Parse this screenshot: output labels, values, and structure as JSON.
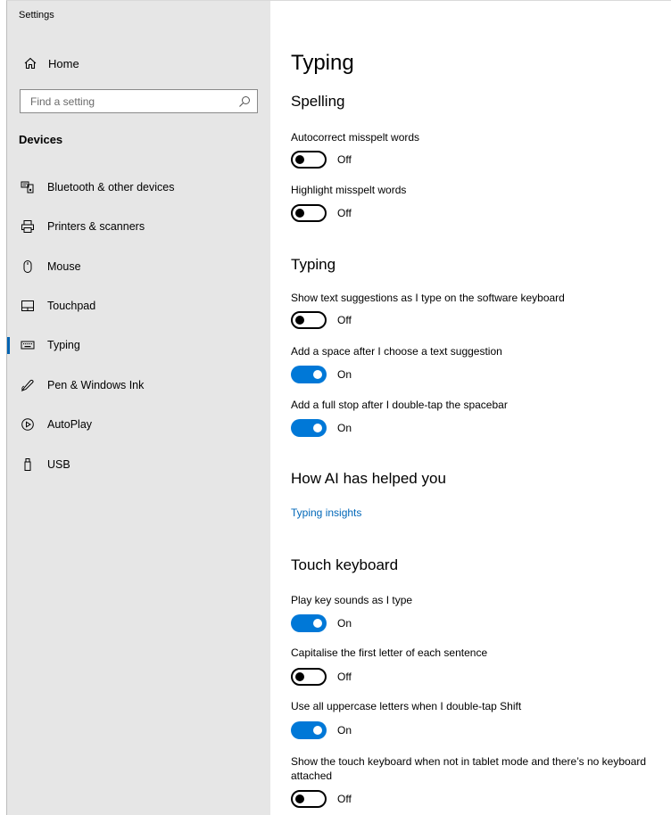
{
  "window": {
    "title": "Settings"
  },
  "sidebar": {
    "home": {
      "label": "Home",
      "icon": "home-icon"
    },
    "search": {
      "placeholder": "Find a setting",
      "value": "",
      "icon": "search-icon"
    },
    "section": "Devices",
    "items": [
      {
        "label": "Bluetooth & other devices",
        "icon": "bluetooth-devices-icon",
        "active": false
      },
      {
        "label": "Printers & scanners",
        "icon": "printer-icon",
        "active": false
      },
      {
        "label": "Mouse",
        "icon": "mouse-icon",
        "active": false
      },
      {
        "label": "Touchpad",
        "icon": "touchpad-icon",
        "active": false
      },
      {
        "label": "Typing",
        "icon": "keyboard-icon",
        "active": true
      },
      {
        "label": "Pen & Windows Ink",
        "icon": "pen-icon",
        "active": false
      },
      {
        "label": "AutoPlay",
        "icon": "autoplay-icon",
        "active": false
      },
      {
        "label": "USB",
        "icon": "usb-icon",
        "active": false
      }
    ]
  },
  "content": {
    "title": "Typing",
    "spelling": {
      "heading": "Spelling",
      "autocorrect": {
        "label": "Autocorrect misspelt words",
        "state": "Off"
      },
      "highlight": {
        "label": "Highlight misspelt words",
        "state": "Off"
      }
    },
    "typing": {
      "heading": "Typing",
      "suggestions": {
        "label": "Show text suggestions as I type on the software keyboard",
        "state": "Off"
      },
      "space": {
        "label": "Add a space after I choose a text suggestion",
        "state": "On"
      },
      "fullstop": {
        "label": "Add a full stop after I double-tap the spacebar",
        "state": "On"
      }
    },
    "ai": {
      "heading": "How AI has helped you",
      "link": "Typing insights"
    },
    "touch": {
      "heading": "Touch keyboard",
      "sounds": {
        "label": "Play key sounds as I type",
        "state": "On"
      },
      "capitalise": {
        "label": "Capitalise the first letter of each sentence",
        "state": "Off"
      },
      "uppercase": {
        "label": "Use all uppercase letters when I double-tap Shift",
        "state": "On"
      },
      "show": {
        "label": "Show the touch keyboard when not in tablet mode and there’s no keyboard attached",
        "state": "Off"
      }
    }
  },
  "colors": {
    "accent": "#0078d7",
    "link": "#0067b8",
    "sidebar_bg": "#e6e6e6"
  }
}
